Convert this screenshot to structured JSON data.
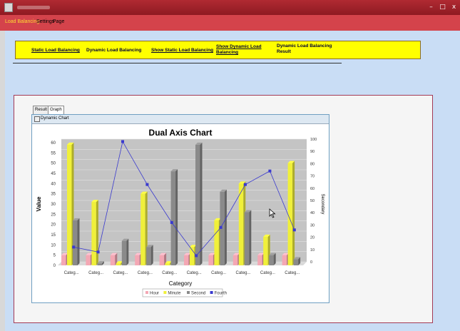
{
  "window": {
    "minimize": "–",
    "maximize": "□",
    "close": "x"
  },
  "tabs": [
    {
      "label": "Load Balancing",
      "active": true,
      "color": "#ffdd33"
    },
    {
      "label": "Settings",
      "active": false,
      "color": "#000000"
    },
    {
      "label": "Page",
      "active": false,
      "color": "#000000"
    }
  ],
  "nav": {
    "static_lb": "Static Load Balancing",
    "dynamic_lb": "Dynamic Load Balancing",
    "show_static_lb": "Show Static Load Balancing",
    "show_dynamic_lb_1": "Show Dynamic Load",
    "show_dynamic_lb_2": "Balancing",
    "dynamic_result_1": "Dynamic Load Balancing",
    "dynamic_result_2": "Result"
  },
  "subtabs": {
    "result": "Result",
    "graph": "Graph"
  },
  "chart_window_title": "Dynamic Chart",
  "chart_data": {
    "type": "bar",
    "title": "Dual Axis Chart",
    "xlabel": "Category",
    "ylabel": "Value",
    "y2label": "Secondary",
    "ylim": [
      0,
      60
    ],
    "y2lim": [
      0,
      100
    ],
    "yticks": [
      0,
      5,
      10,
      15,
      20,
      25,
      30,
      35,
      40,
      45,
      50,
      55,
      60
    ],
    "y2ticks": [
      0,
      10,
      20,
      30,
      40,
      50,
      60,
      70,
      80,
      90,
      100
    ],
    "categories": [
      "Categ...",
      "Categ...",
      "Categ...",
      "Categ...",
      "Categ...",
      "Categ...",
      "Categ...",
      "Categ...",
      "Categ...",
      "Categ..."
    ],
    "series": [
      {
        "name": "Hour",
        "color": "#f4a7b4",
        "values": [
          5,
          5,
          5,
          5,
          5,
          5,
          5,
          5,
          5,
          5
        ]
      },
      {
        "name": "Minute",
        "color": "#f0f03a",
        "values": [
          59,
          31,
          1,
          35,
          1,
          9,
          22,
          40,
          14,
          50
        ]
      },
      {
        "name": "Second",
        "color": "#8a8a8a",
        "values": [
          22,
          1,
          12,
          9,
          46,
          59,
          36,
          26,
          5,
          3
        ]
      }
    ],
    "line_series": {
      "name": "Fourth",
      "color": "#3a3acf",
      "axis": "secondary",
      "values": [
        12,
        8,
        98,
        63,
        32,
        5,
        28,
        63,
        74,
        26
      ]
    },
    "legend_position": "bottom",
    "grid": true
  }
}
